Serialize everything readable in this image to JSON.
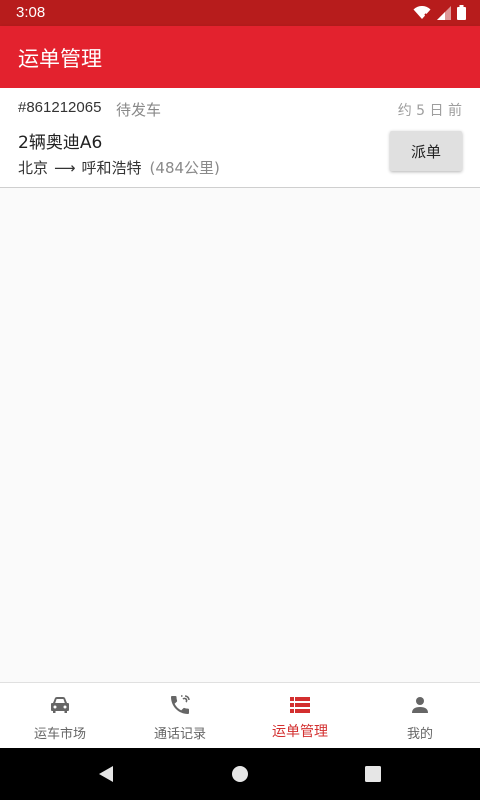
{
  "status_bar": {
    "time": "3:08"
  },
  "app_bar": {
    "title": "运单管理"
  },
  "order": {
    "id": "#861212065",
    "status": "待发车",
    "time_ago": "约 5 日 前",
    "vehicle": "2辆奥迪A6",
    "origin": "北京",
    "arrow": "⟶",
    "destination": "呼和浩特",
    "distance": "(484公里)",
    "dispatch_label": "派单"
  },
  "bottom_nav": {
    "items": [
      {
        "label": "运车市场",
        "icon": "car-icon"
      },
      {
        "label": "通话记录",
        "icon": "phone-icon"
      },
      {
        "label": "运单管理",
        "icon": "list-icon",
        "active": true
      },
      {
        "label": "我的",
        "icon": "person-icon"
      }
    ]
  },
  "colors": {
    "primary": "#e3222e",
    "status_bar": "#b71c1c",
    "active_tab": "#d32f2f",
    "inactive_tab": "#666666"
  }
}
